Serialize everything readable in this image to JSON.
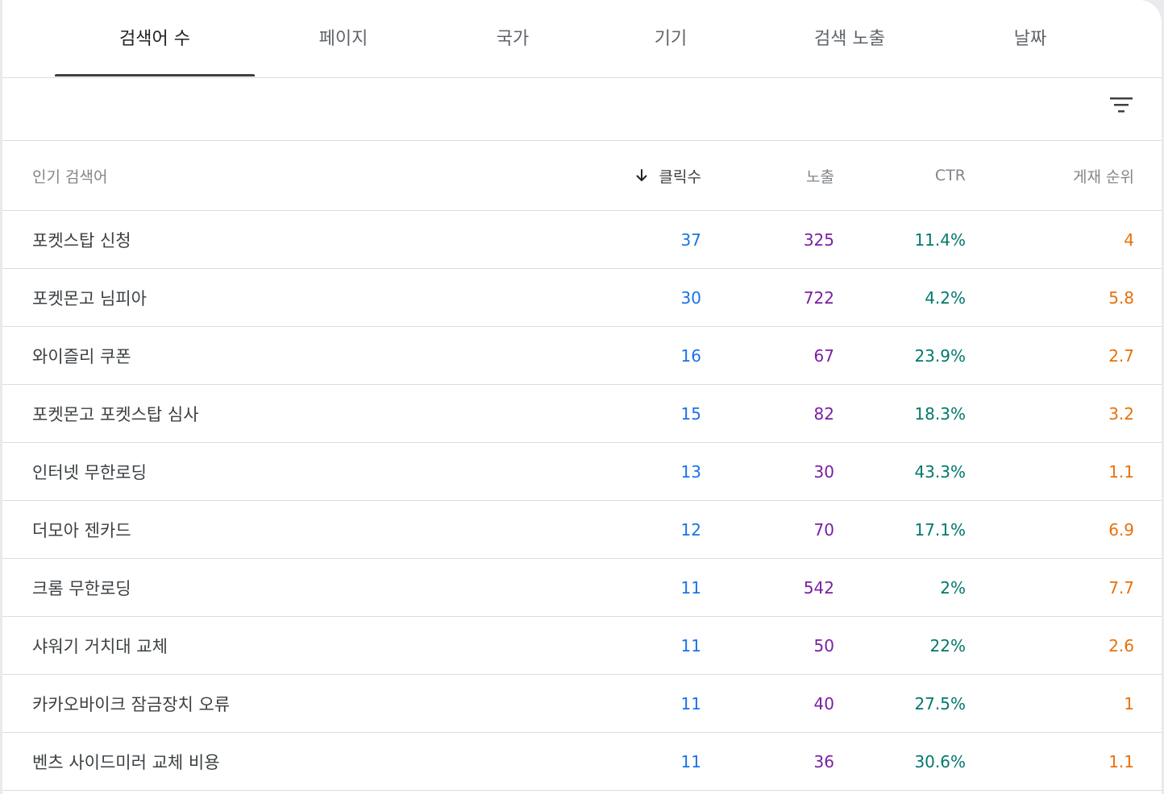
{
  "tabs": [
    "검색어 수",
    "페이지",
    "국가",
    "기기",
    "검색 노출",
    "날짜"
  ],
  "active_tab_index": 0,
  "filter": {
    "icon": "filter-icon"
  },
  "table": {
    "columns": {
      "query": "인기 검색어",
      "clicks": "클릭수",
      "impressions": "노출",
      "ctr": "CTR",
      "position": "게재 순위"
    },
    "sort": {
      "column": "clicks",
      "direction": "descending",
      "icon": "arrow-down-icon"
    },
    "rows": [
      {
        "query": "포켓스탑 신청",
        "clicks": "37",
        "impressions": "325",
        "ctr": "11.4%",
        "position": "4"
      },
      {
        "query": "포켓몬고 님피아",
        "clicks": "30",
        "impressions": "722",
        "ctr": "4.2%",
        "position": "5.8"
      },
      {
        "query": "와이즐리 쿠폰",
        "clicks": "16",
        "impressions": "67",
        "ctr": "23.9%",
        "position": "2.7"
      },
      {
        "query": "포켓몬고 포켓스탑 심사",
        "clicks": "15",
        "impressions": "82",
        "ctr": "18.3%",
        "position": "3.2"
      },
      {
        "query": "인터넷 무한로딩",
        "clicks": "13",
        "impressions": "30",
        "ctr": "43.3%",
        "position": "1.1"
      },
      {
        "query": "더모아 젠카드",
        "clicks": "12",
        "impressions": "70",
        "ctr": "17.1%",
        "position": "6.9"
      },
      {
        "query": "크롬 무한로딩",
        "clicks": "11",
        "impressions": "542",
        "ctr": "2%",
        "position": "7.7"
      },
      {
        "query": "샤워기 거치대 교체",
        "clicks": "11",
        "impressions": "50",
        "ctr": "22%",
        "position": "2.6"
      },
      {
        "query": "카카오바이크 잠금장치 오류",
        "clicks": "11",
        "impressions": "40",
        "ctr": "27.5%",
        "position": "1"
      },
      {
        "query": "벤츠 사이드미러 교체 비용",
        "clicks": "11",
        "impressions": "36",
        "ctr": "30.6%",
        "position": "1.1"
      }
    ]
  },
  "colors": {
    "clicks": "#1a73e8",
    "impressions": "#7b1fa2",
    "ctr": "#00796b",
    "position": "#e8710a"
  }
}
